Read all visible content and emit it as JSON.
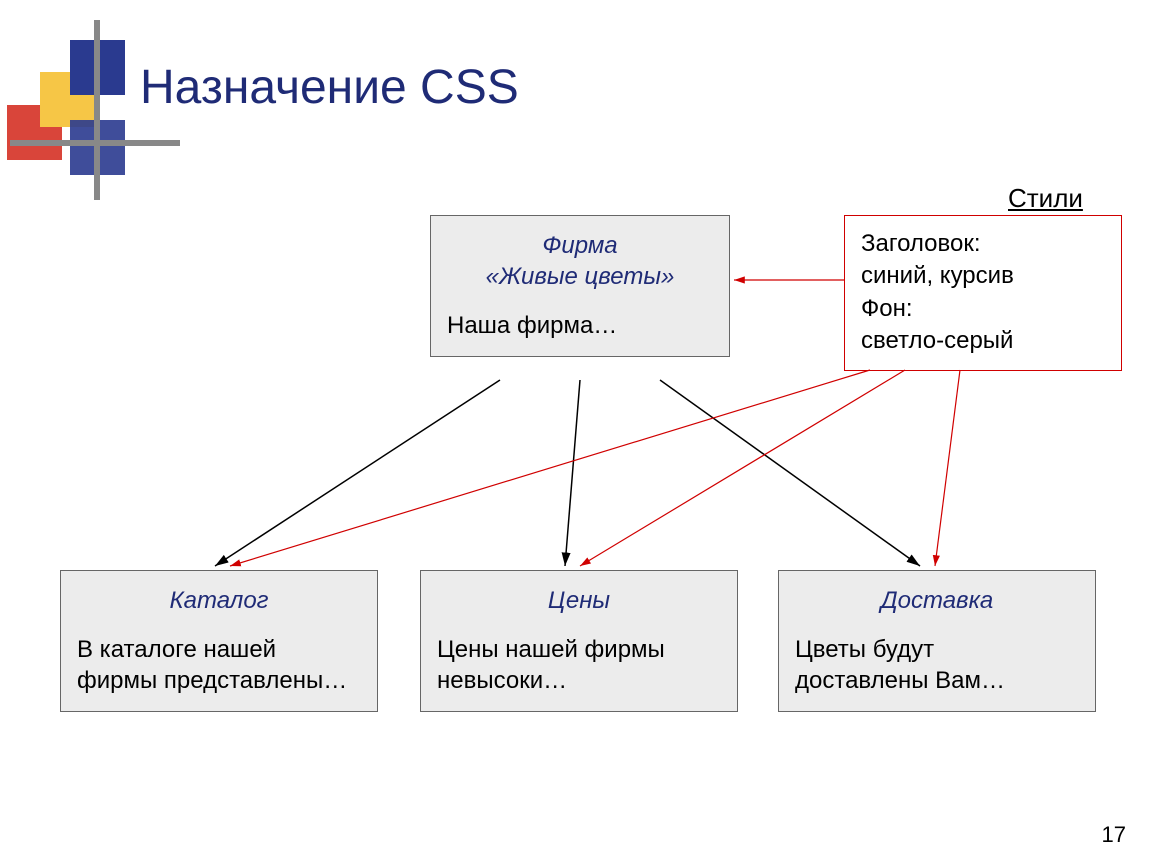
{
  "slide": {
    "title": "Назначение CSS",
    "page_number": "17"
  },
  "styles_label": "Стили",
  "main_box": {
    "heading_line1": "Фирма",
    "heading_line2": "«Живые цветы»",
    "body": "Наша фирма…"
  },
  "styles_box": {
    "line1": "Заголовок:",
    "line2": "синий, курсив",
    "line3": "Фон:",
    "line4": "светло-серый"
  },
  "children": [
    {
      "heading": "Каталог",
      "body_line1": "В каталоге нашей",
      "body_line2": "фирмы представлены…"
    },
    {
      "heading": "Цены",
      "body_line1": "Цены нашей фирмы",
      "body_line2": "невысоки…"
    },
    {
      "heading": "Доставка",
      "body_line1": "Цветы будут",
      "body_line2": "доставлены Вам…"
    }
  ]
}
